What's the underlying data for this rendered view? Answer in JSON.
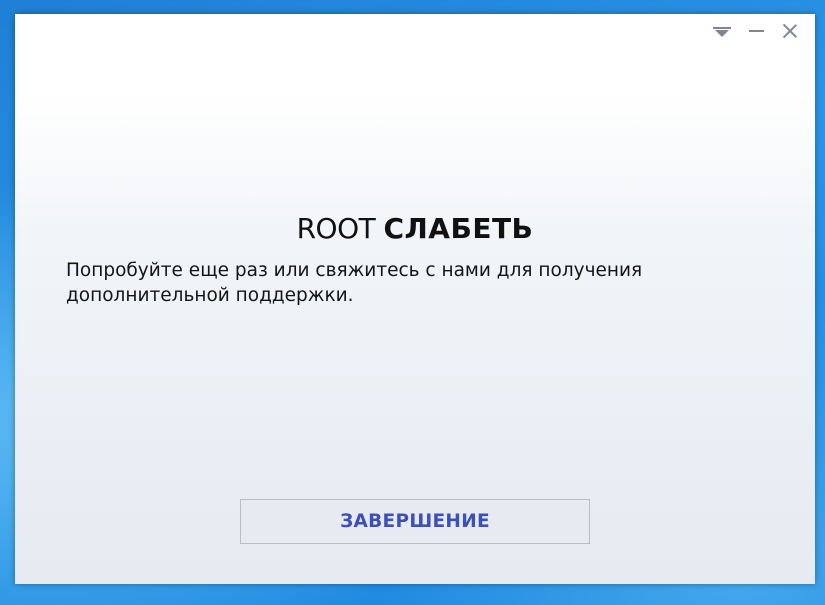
{
  "window": {
    "controls": {
      "menu_icon": "dropdown-menu-icon",
      "minimize_icon": "minimize-icon",
      "close_icon": "close-icon"
    }
  },
  "dialog": {
    "title_prefix": "ROOT",
    "title_emphasis": "СЛАБЕТЬ",
    "message": "Попробуйте еще раз или свяжитесь с нами для получения дополнительной поддержки.",
    "finish_button_label": "ЗАВЕРШЕНИЕ"
  },
  "colors": {
    "desktop_background": "#2a96e8",
    "window_background": "#eef1f6",
    "button_text": "#3d50b8",
    "title_text": "#111111"
  }
}
